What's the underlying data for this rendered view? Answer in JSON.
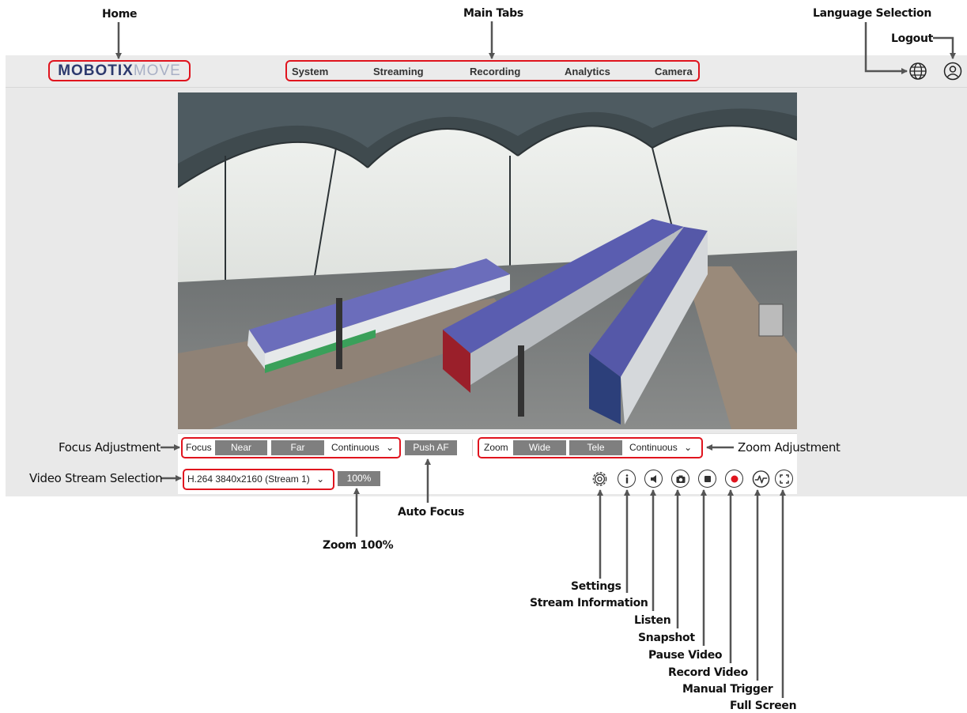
{
  "callouts": {
    "home": "Home",
    "main_tabs": "Main Tabs",
    "language_selection": "Language Selection",
    "logout": "Logout",
    "focus_adjustment": "Focus Adjustment",
    "zoom_adjustment": "Zoom Adjustment",
    "video_stream_selection": "Video Stream Selection",
    "auto_focus": "Auto Focus",
    "zoom_100": "Zoom 100%",
    "settings": "Settings",
    "stream_information": "Stream Information",
    "listen": "Listen",
    "snapshot": "Snapshot",
    "pause_video": "Pause Video",
    "record_video": "Record Video",
    "manual_trigger": "Manual Trigger",
    "full_screen": "Full Screen"
  },
  "logo": {
    "part1": "MOBOTIX",
    "part2": "MOVE"
  },
  "tabs": [
    "System",
    "Streaming",
    "Recording",
    "Analytics",
    "Camera"
  ],
  "focus": {
    "label": "Focus",
    "near": "Near",
    "far": "Far",
    "mode": "Continuous",
    "push_af": "Push AF"
  },
  "zoom": {
    "label": "Zoom",
    "wide": "Wide",
    "tele": "Tele",
    "mode": "Continuous"
  },
  "stream": {
    "selected": "H.264 3840x2160 (Stream 1)",
    "zoom_level": "100%"
  },
  "icons": [
    "globe-icon",
    "user-icon",
    "gear-icon",
    "info-icon",
    "speaker-icon",
    "camera-icon",
    "stop-icon",
    "record-icon",
    "pulse-icon",
    "fullscreen-icon"
  ],
  "colors": {
    "accent_red": "#e0141e",
    "button_gray": "#7f7f7f",
    "logo_navy": "#2d3a6e",
    "logo_light": "#a9b0c5"
  }
}
